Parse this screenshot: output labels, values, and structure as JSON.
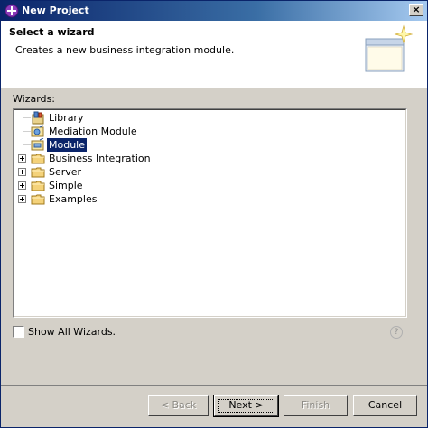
{
  "window": {
    "title": "New Project",
    "close_glyph": "×"
  },
  "banner": {
    "title": "Select a wizard",
    "description": "Creates a new business integration module."
  },
  "wizards": {
    "label": "Wizards:",
    "items": [
      {
        "label": "Library",
        "icon": "library-icon",
        "expandable": false,
        "selected": false
      },
      {
        "label": "Mediation Module",
        "icon": "mediation-module-icon",
        "expandable": false,
        "selected": false
      },
      {
        "label": "Module",
        "icon": "module-icon",
        "expandable": false,
        "selected": true
      },
      {
        "label": "Business Integration",
        "icon": "folder-icon",
        "expandable": true,
        "selected": false
      },
      {
        "label": "Server",
        "icon": "folder-icon",
        "expandable": true,
        "selected": false
      },
      {
        "label": "Simple",
        "icon": "folder-icon",
        "expandable": true,
        "selected": false
      },
      {
        "label": "Examples",
        "icon": "folder-icon",
        "expandable": true,
        "selected": false
      }
    ]
  },
  "show_all": {
    "label": "Show All Wizards.",
    "checked": false
  },
  "help": {
    "glyph": "?"
  },
  "buttons": {
    "back": "< Back",
    "next": "Next >",
    "finish": "Finish",
    "cancel": "Cancel"
  }
}
